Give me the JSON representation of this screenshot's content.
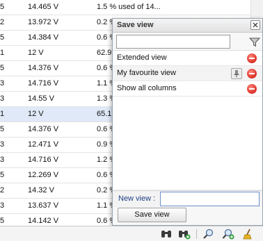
{
  "table": {
    "rows": [
      {
        "c0": "5",
        "c1": "14.465 V",
        "c2": "1.5 % used of 14...",
        "selected": false
      },
      {
        "c0": "2",
        "c1": "13.972 V",
        "c2": "0.2 %",
        "selected": false
      },
      {
        "c0": "5",
        "c1": "14.384 V",
        "c2": "0.6 %",
        "selected": false
      },
      {
        "c0": "1",
        "c1": "12 V",
        "c2": "62.9",
        "selected": false
      },
      {
        "c0": "5",
        "c1": "14.376 V",
        "c2": "0.6 %",
        "selected": false
      },
      {
        "c0": "3",
        "c1": "14.716 V",
        "c2": "1.1 %",
        "selected": false
      },
      {
        "c0": "3",
        "c1": "14.55 V",
        "c2": "1.3 %",
        "selected": false
      },
      {
        "c0": "1",
        "c1": "12 V",
        "c2": "65.1",
        "selected": true
      },
      {
        "c0": "5",
        "c1": "14.376 V",
        "c2": "0.6 %",
        "selected": false
      },
      {
        "c0": "3",
        "c1": "12.471 V",
        "c2": "0.9 %",
        "selected": false
      },
      {
        "c0": "3",
        "c1": "14.716 V",
        "c2": "1.2 %",
        "selected": false
      },
      {
        "c0": "5",
        "c1": "12.269 V",
        "c2": "0.6 %",
        "selected": false
      },
      {
        "c0": "2",
        "c1": "14.32 V",
        "c2": "0.2 %",
        "selected": false
      },
      {
        "c0": "3",
        "c1": "13.637 V",
        "c2": "1.1 %",
        "selected": false
      },
      {
        "c0": "5",
        "c1": "14.142 V",
        "c2": "0.6 %",
        "selected": false
      }
    ]
  },
  "popup": {
    "title": "Save view",
    "close_icon": "close-icon",
    "filter_value": "",
    "filter_icon": "filter-icon",
    "views": [
      {
        "label": "Extended view",
        "pinned": false
      },
      {
        "label": "My favourite view",
        "pinned": true
      },
      {
        "label": "Show all columns",
        "pinned": false
      }
    ],
    "new_view_label": "New view :",
    "new_view_value": "",
    "save_button": "Save view"
  },
  "toolbar": {
    "icons": [
      "binoculars-icon",
      "binoculars-add-icon",
      "zoom-icon",
      "zoom-add-icon",
      "broom-icon"
    ]
  },
  "colors": {
    "selected_row": "#dfe9f7",
    "delete": "#e0392f",
    "label_blue": "#1f3e86"
  }
}
